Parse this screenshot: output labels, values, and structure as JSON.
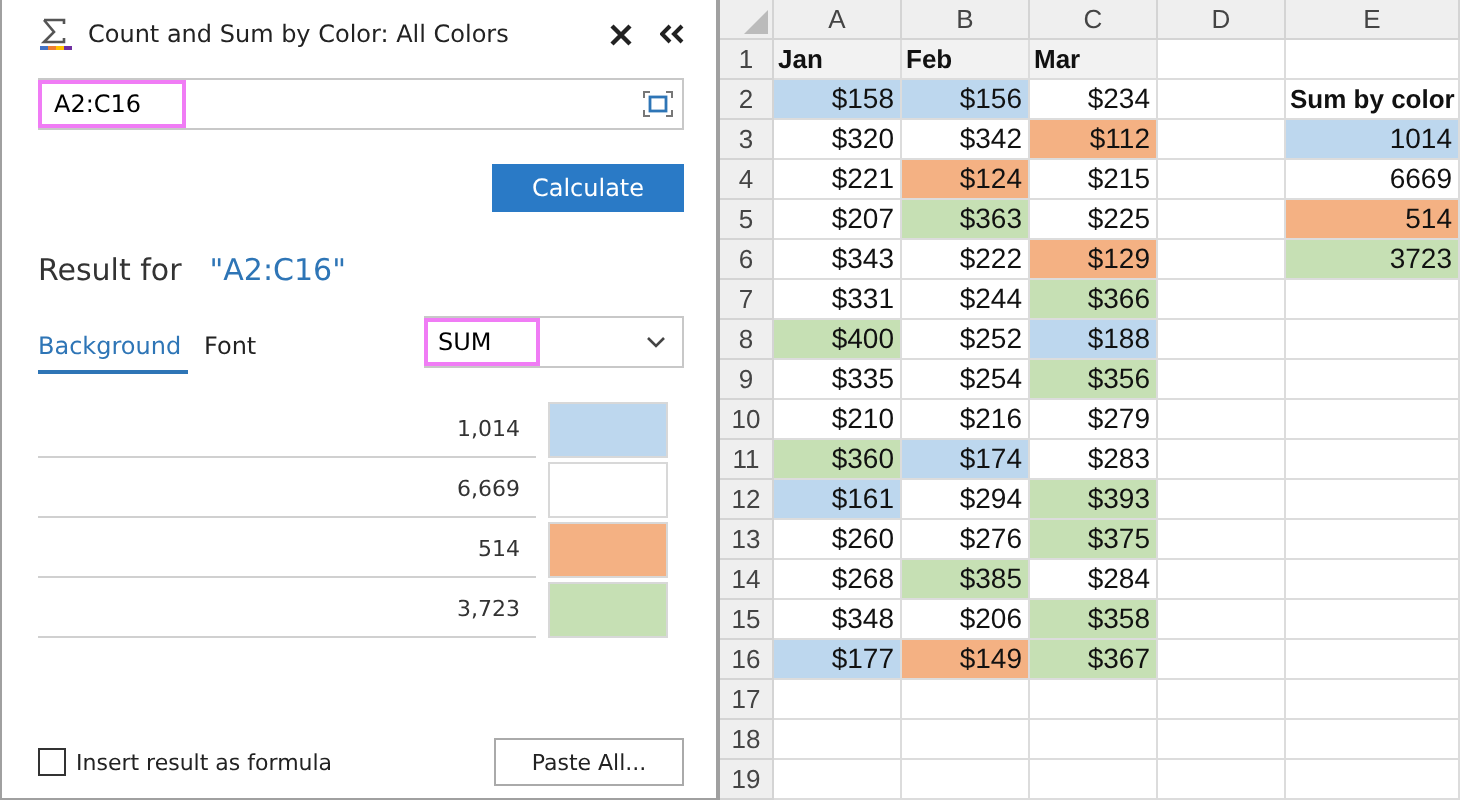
{
  "pane": {
    "title": "Count and Sum by Color: All Colors",
    "range_field": {
      "value": "A2:C16",
      "highlighted": true
    },
    "calculate_button": "Calculate",
    "result_label": "Result for",
    "result_range": "\"A2:C16\"",
    "tabs": [
      {
        "label": "Background",
        "selected": true
      },
      {
        "label": "Font",
        "selected": false
      }
    ],
    "function_dropdown": {
      "value": "SUM",
      "highlighted": true
    },
    "results": [
      {
        "value": "1,014",
        "color": "#bdd7ee"
      },
      {
        "value": "6,669",
        "color": "#ffffff"
      },
      {
        "value": "514",
        "color": "#f4b183"
      },
      {
        "value": "3,723",
        "color": "#c6e0b4"
      }
    ],
    "insert_formula": {
      "label": "Insert result as formula",
      "checked": false
    },
    "paste_button": "Paste All..."
  },
  "sheet": {
    "columns": [
      "A",
      "B",
      "C",
      "D",
      "E"
    ],
    "rows": [
      {
        "number": "1",
        "cells": [
          {
            "text": "Jan",
            "bold": true,
            "color": "#f2f2f2"
          },
          {
            "text": "Feb",
            "bold": true,
            "color": "#f2f2f2"
          },
          {
            "text": "Mar",
            "bold": true,
            "color": "#f2f2f2"
          },
          {},
          {}
        ]
      },
      {
        "number": "2",
        "cells": [
          {
            "text": "$158",
            "color": "#bdd7ee"
          },
          {
            "text": "$156",
            "color": "#bdd7ee"
          },
          {
            "text": "$234"
          },
          {},
          {
            "text": "Sum by color",
            "bold": true
          }
        ]
      },
      {
        "number": "3",
        "cells": [
          {
            "text": "$320"
          },
          {
            "text": "$342"
          },
          {
            "text": "$112",
            "color": "#f4b183"
          },
          {},
          {
            "text": "1014",
            "color": "#bdd7ee"
          }
        ]
      },
      {
        "number": "4",
        "cells": [
          {
            "text": "$221"
          },
          {
            "text": "$124",
            "color": "#f4b183"
          },
          {
            "text": "$215"
          },
          {},
          {
            "text": "6669"
          }
        ]
      },
      {
        "number": "5",
        "cells": [
          {
            "text": "$207"
          },
          {
            "text": "$363",
            "color": "#c6e0b4"
          },
          {
            "text": "$225"
          },
          {},
          {
            "text": "514",
            "color": "#f4b183"
          }
        ]
      },
      {
        "number": "6",
        "cells": [
          {
            "text": "$343"
          },
          {
            "text": "$222"
          },
          {
            "text": "$129",
            "color": "#f4b183"
          },
          {},
          {
            "text": "3723",
            "color": "#c6e0b4"
          }
        ]
      },
      {
        "number": "7",
        "cells": [
          {
            "text": "$331"
          },
          {
            "text": "$244"
          },
          {
            "text": "$366",
            "color": "#c6e0b4"
          },
          {},
          {}
        ]
      },
      {
        "number": "8",
        "cells": [
          {
            "text": "$400",
            "color": "#c6e0b4"
          },
          {
            "text": "$252"
          },
          {
            "text": "$188",
            "color": "#bdd7ee"
          },
          {},
          {}
        ]
      },
      {
        "number": "9",
        "cells": [
          {
            "text": "$335"
          },
          {
            "text": "$254"
          },
          {
            "text": "$356",
            "color": "#c6e0b4"
          },
          {},
          {}
        ]
      },
      {
        "number": "10",
        "cells": [
          {
            "text": "$210"
          },
          {
            "text": "$216"
          },
          {
            "text": "$279"
          },
          {},
          {}
        ]
      },
      {
        "number": "11",
        "cells": [
          {
            "text": "$360",
            "color": "#c6e0b4"
          },
          {
            "text": "$174",
            "color": "#bdd7ee"
          },
          {
            "text": "$283"
          },
          {},
          {}
        ]
      },
      {
        "number": "12",
        "cells": [
          {
            "text": "$161",
            "color": "#bdd7ee"
          },
          {
            "text": "$294"
          },
          {
            "text": "$393",
            "color": "#c6e0b4"
          },
          {},
          {}
        ]
      },
      {
        "number": "13",
        "cells": [
          {
            "text": "$260"
          },
          {
            "text": "$276"
          },
          {
            "text": "$375",
            "color": "#c6e0b4"
          },
          {},
          {}
        ]
      },
      {
        "number": "14",
        "cells": [
          {
            "text": "$268"
          },
          {
            "text": "$385",
            "color": "#c6e0b4"
          },
          {
            "text": "$284"
          },
          {},
          {}
        ]
      },
      {
        "number": "15",
        "cells": [
          {
            "text": "$348"
          },
          {
            "text": "$206"
          },
          {
            "text": "$358",
            "color": "#c6e0b4"
          },
          {},
          {}
        ]
      },
      {
        "number": "16",
        "cells": [
          {
            "text": "$177",
            "color": "#bdd7ee"
          },
          {
            "text": "$149",
            "color": "#f4b183"
          },
          {
            "text": "$367",
            "color": "#c6e0b4"
          },
          {},
          {}
        ]
      },
      {
        "number": "17",
        "cells": [
          {},
          {},
          {},
          {},
          {}
        ]
      },
      {
        "number": "18",
        "cells": [
          {},
          {},
          {},
          {},
          {}
        ]
      },
      {
        "number": "19",
        "cells": [
          {},
          {},
          {},
          {},
          {}
        ]
      }
    ]
  }
}
